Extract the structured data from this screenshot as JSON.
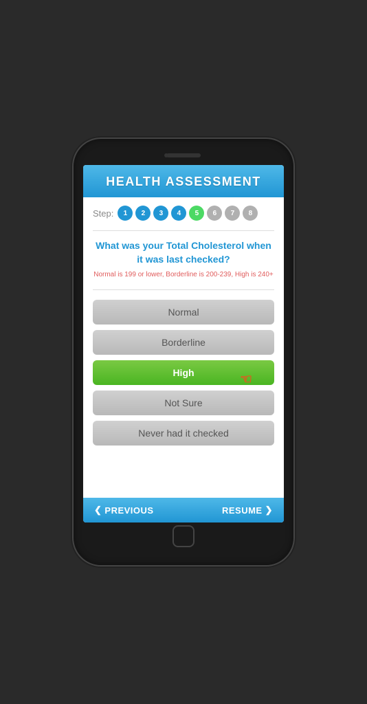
{
  "header": {
    "title": "HEALTH ASSESSMENT"
  },
  "steps": {
    "label": "Step:",
    "items": [
      {
        "number": "1",
        "state": "completed"
      },
      {
        "number": "2",
        "state": "completed"
      },
      {
        "number": "3",
        "state": "completed"
      },
      {
        "number": "4",
        "state": "completed"
      },
      {
        "number": "5",
        "state": "active"
      },
      {
        "number": "6",
        "state": "inactive"
      },
      {
        "number": "7",
        "state": "inactive"
      },
      {
        "number": "8",
        "state": "inactive"
      }
    ]
  },
  "question": {
    "text": "What was your Total Cholesterol when it was last checked?",
    "sub_info": "Normal is 199 or lower, Borderline is 200-239, High is 240+"
  },
  "options": [
    {
      "label": "Normal",
      "state": "default"
    },
    {
      "label": "Borderline",
      "state": "default"
    },
    {
      "label": "High",
      "state": "selected"
    },
    {
      "label": "Not Sure",
      "state": "default"
    },
    {
      "label": "Never had it checked",
      "state": "default"
    }
  ],
  "footer": {
    "previous_label": "PREVIOUS",
    "resume_label": "RESUME"
  }
}
